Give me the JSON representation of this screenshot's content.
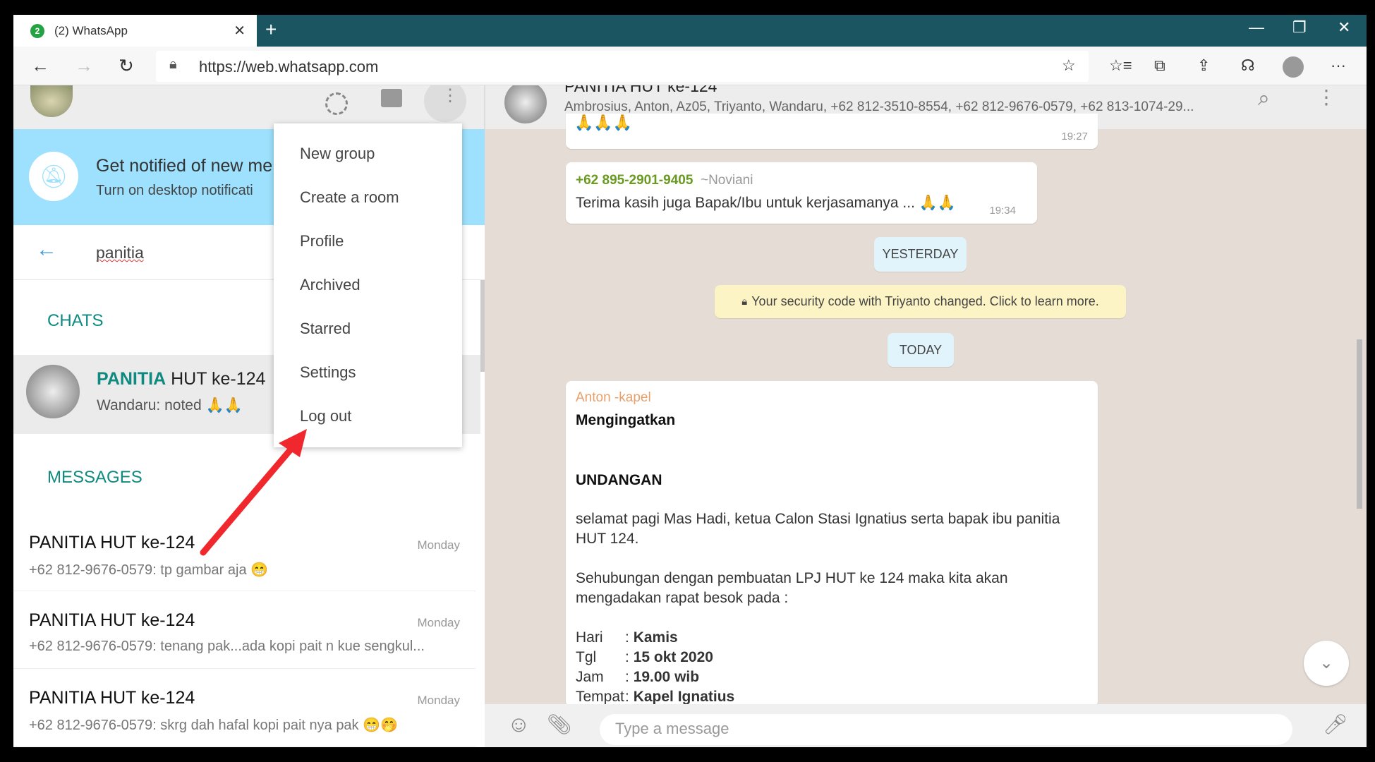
{
  "browser": {
    "tab_title": "(2) WhatsApp",
    "tab_badge": "2",
    "url": "https://web.whatsapp.com",
    "icons": [
      "back-icon",
      "forward-icon",
      "refresh-icon",
      "lock-icon",
      "star-icon",
      "favorites-icon",
      "collections-icon",
      "share-icon",
      "feedback-icon",
      "profile-icon",
      "more-icon"
    ]
  },
  "sidebar": {
    "notification": {
      "title": "Get notified of new me",
      "subtitle": "Turn on desktop notificati"
    },
    "search_value": "panitia",
    "chats_header": "CHATS",
    "chat": {
      "name_highlight": "PANITIA",
      "name_rest": " HUT ke-124",
      "preview": "Wandaru: noted 🙏🙏"
    },
    "messages_header": "MESSAGES",
    "messages": [
      {
        "title": "PANITIA HUT ke-124",
        "preview": "+62 812-9676-0579: tp gambar aja 😁",
        "date": "Monday"
      },
      {
        "title": "PANITIA HUT ke-124",
        "preview": "+62 812-9676-0579: tenang pak...ada kopi pait n kue sengkul...",
        "date": "Monday"
      },
      {
        "title": "PANITIA HUT ke-124",
        "preview": "+62 812-9676-0579: skrg dah hafal kopi pait nya pak 😁🤭",
        "date": "Monday"
      }
    ]
  },
  "menu": {
    "items": [
      "New group",
      "Create a room",
      "Profile",
      "Archived",
      "Starred",
      "Settings",
      "Log out"
    ]
  },
  "chat": {
    "title": "PANITIA HUT ke-124",
    "members": "Ambrosius, Anton, Az05, Triyanto, Wandaru, +62 812-3510-8554, +62 812-9676-0579, +62 813-1074-29...",
    "msg1": {
      "text": "🙏🙏🙏",
      "time": "19:27"
    },
    "msg2": {
      "sender": "+62 895-2901-9405",
      "alias": "~Noviani",
      "text": "Terima kasih juga Bapak/Ibu untuk kerjasamanya ... 🙏🙏",
      "time": "19:34"
    },
    "yesterday": "YESTERDAY",
    "security": "Your security code with Triyanto changed. Click to learn more.",
    "today": "TODAY",
    "msg3": {
      "sender": "Anton -kapel",
      "heading": "Mengingatkan",
      "subheading": "UNDANGAN",
      "p1": "selamat pagi Mas Hadi, ketua Calon Stasi Ignatius serta  bapak ibu panitia HUT 124.",
      "p2": "Sehubungan dengan pembuatan LPJ HUT ke 124 maka kita akan mengadakan rapat besok pada :",
      "rows": [
        {
          "label": "Hari",
          "sep": ":",
          "value": "Kamis"
        },
        {
          "label": "Tgl",
          "sep": ":",
          "value": "15 okt 2020"
        },
        {
          "label": "Jam",
          "sep": ":",
          "value": "19.00 wib"
        },
        {
          "label": "Tempat",
          "sep": ":",
          "value": "Kapel Ignatius"
        }
      ]
    },
    "input_placeholder": "Type a message"
  },
  "colors": {
    "accent": "#0e8a80",
    "tabbar": "#1b5562",
    "annotation_arrow": "#f0282d",
    "notif_banner": "#9de1fe"
  }
}
